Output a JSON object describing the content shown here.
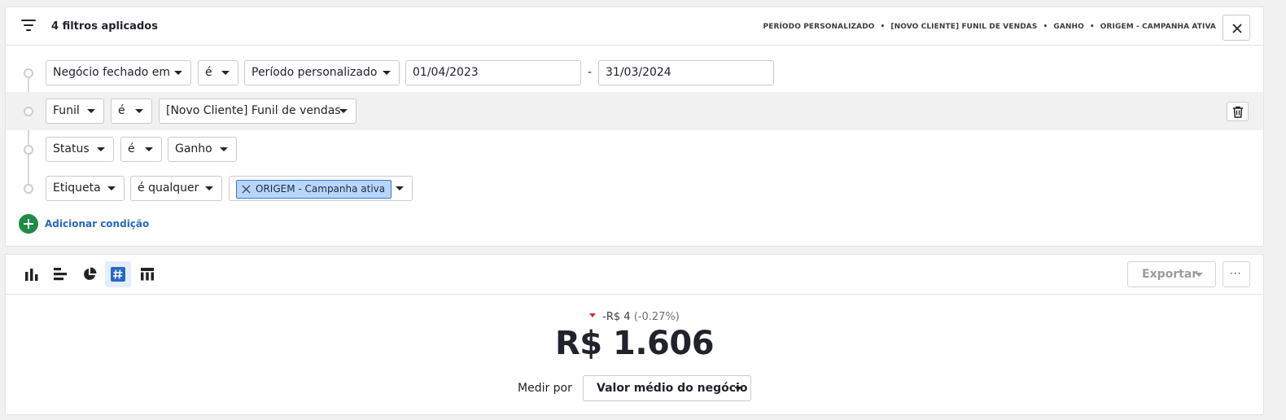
{
  "filters": {
    "count_label": "4 filtros aplicados",
    "summary": [
      "PERÍODO PERSONALIZADO",
      "[NOVO CLIENTE] FUNIL DE VENDAS",
      "GANHO",
      "ORIGEM - CAMPANHA ATIVA"
    ],
    "summary_separator": "•",
    "rows": [
      {
        "field": "Negócio fechado em",
        "operator": "é",
        "value": "Período personalizado",
        "date_from": "01/04/2023",
        "date_separator": "-",
        "date_to": "31/03/2024"
      },
      {
        "field": "Funil",
        "operator": "é",
        "value": "[Novo Cliente] Funil de vendas"
      },
      {
        "field": "Status",
        "operator": "é",
        "value": "Ganho"
      },
      {
        "field": "Etiqueta",
        "operator": "é qualquer",
        "tag": "ORIGEM - Campanha ativa"
      }
    ],
    "add_condition_label": "Adicionar condição"
  },
  "report": {
    "viz_icons": [
      "bar-chart-icon",
      "horizontal-bar-icon",
      "pie-chart-icon",
      "number-icon",
      "table-icon"
    ],
    "active_viz": "number-icon",
    "export_label": "Exportar",
    "more_label": "···",
    "change_value": "-R$ 4",
    "change_pct": "(-0.27%)",
    "change_direction": "down",
    "value": "R$ 1.606",
    "measure_label": "Medir por",
    "measure_value": "Valor médio do negócio"
  },
  "colors": {
    "accent_blue": "#2a67c4",
    "add_green": "#208a46",
    "tag_fill": "#b8d6fb",
    "down_red": "#d62a2a",
    "highlight_row": "#f1f1f1"
  }
}
